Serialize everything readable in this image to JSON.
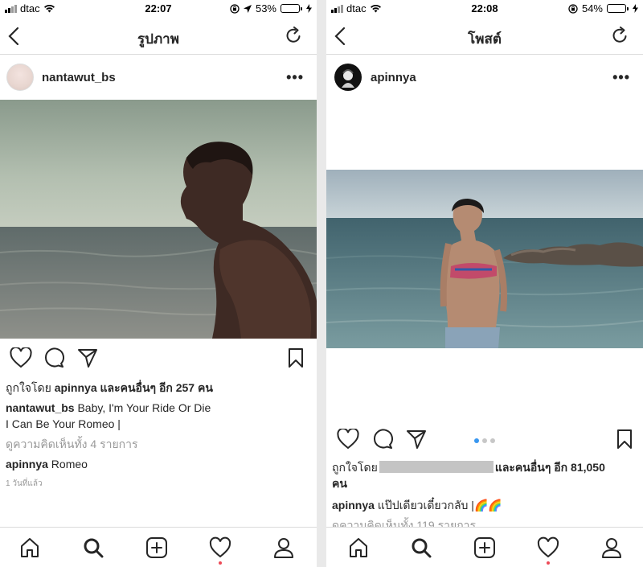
{
  "left": {
    "status": {
      "carrier": "dtac",
      "time": "22:07",
      "battery": "53%",
      "battery_level": 0.53
    },
    "nav": {
      "title": "รูปภาพ"
    },
    "post": {
      "username": "nantawut_bs",
      "likes_prefix": "ถูกใจโดย ",
      "liked_by": "apinnya",
      "likes_suffix": " และคนอื่นๆ อีก 257 คน",
      "caption_user": "nantawut_bs",
      "caption_line1": "Baby, I'm Your Ride Or Die",
      "caption_line2": "I Can Be Your Romeo |",
      "view_comments": "ดูความคิดเห็นทั้ง 4 รายการ",
      "comment_user": "apinnya",
      "comment_text": "Romeo",
      "timestamp": "1 วันที่แล้ว"
    }
  },
  "right": {
    "status": {
      "carrier": "dtac",
      "time": "22:08",
      "battery": "54%",
      "battery_level": 0.54
    },
    "nav": {
      "title": "โพสต์"
    },
    "post": {
      "username": "apinnya",
      "carousel_count": 3,
      "carousel_active": 0,
      "likes_prefix": "ถูกใจโดย",
      "likes_suffix": "และคนอื่นๆ อีก 81,050",
      "likes_line2": "คน",
      "caption_user": "apinnya",
      "caption_text": "แป๊ปเดียวเดี๋ยวกลับ |🌈🌈",
      "view_comments": "ดูความคิดเห็นทั้ง 119 รายการ"
    }
  },
  "colors": {
    "like_dot": "#ed4956",
    "carousel_active": "#3897f0",
    "battery": "#f5c400"
  },
  "icons": [
    "back-icon",
    "refresh-icon",
    "more-icon",
    "heart-icon",
    "comment-icon",
    "share-icon",
    "bookmark-icon",
    "home-icon",
    "search-icon",
    "add-icon",
    "activity-icon",
    "profile-icon"
  ]
}
